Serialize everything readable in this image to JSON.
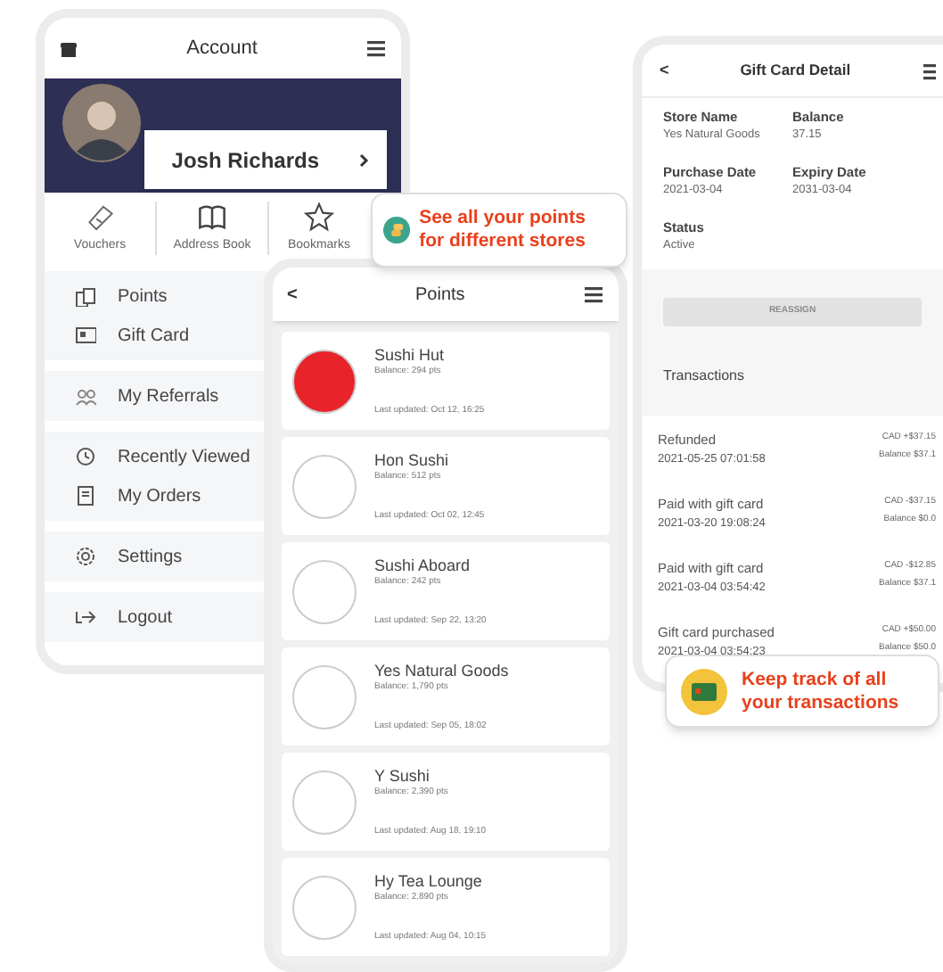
{
  "account_screen": {
    "title": "Account",
    "profile": {
      "name": "Josh Richards"
    },
    "shortcuts": [
      {
        "label": "Vouchers"
      },
      {
        "label": "Address Book"
      },
      {
        "label": "Bookmarks"
      }
    ],
    "menu_groups": [
      {
        "items": [
          {
            "label": "Points"
          },
          {
            "label": "Gift Card"
          }
        ]
      },
      {
        "items": [
          {
            "label": "My Referrals"
          }
        ]
      },
      {
        "items": [
          {
            "label": "Recently Viewed"
          },
          {
            "label": "My Orders"
          }
        ]
      },
      {
        "items": [
          {
            "label": "Settings"
          }
        ]
      },
      {
        "items": [
          {
            "label": "Logout"
          }
        ]
      }
    ]
  },
  "points_callout": {
    "text": "See all your points for different stores"
  },
  "points_screen": {
    "title": "Points",
    "back": "<",
    "stores": [
      {
        "name": "Sushi Hut",
        "balance": "Balance: 294 pts",
        "updated": "Last updated: Oct 12, 16:25",
        "color": "#e8232a"
      },
      {
        "name": "Hon Sushi",
        "balance": "Balance: 512 pts",
        "updated": "Last updated: Oct 02, 12:45",
        "color": "#ffffff"
      },
      {
        "name": "Sushi Aboard",
        "balance": "Balance: 242 pts",
        "updated": "Last updated: Sep 22, 13:20",
        "color": "#ffffff"
      },
      {
        "name": "Yes Natural Goods",
        "balance": "Balance: 1,790 pts",
        "updated": "Last updated: Sep 05, 18:02",
        "color": "#ffffff"
      },
      {
        "name": "Y Sushi",
        "balance": "Balance: 2,390 pts",
        "updated": "Last updated: Aug 18, 19:10",
        "color": "#ffffff"
      },
      {
        "name": "Hy Tea Lounge",
        "balance": "Balance: 2,890 pts",
        "updated": "Last updated: Aug 04, 10:15",
        "color": "#ffffff"
      }
    ]
  },
  "gift_card_screen": {
    "title": "Gift Card Detail",
    "back": "<",
    "fields": [
      {
        "label": "Store Name",
        "value": "Yes Natural Goods"
      },
      {
        "label": "Balance",
        "value": "37.15"
      },
      {
        "label": "Purchase Date",
        "value": "2021-03-04"
      },
      {
        "label": "Expiry Date",
        "value": "2031-03-04"
      },
      {
        "label": "Status",
        "value": "Active"
      }
    ],
    "reassign_button": {
      "label": "REASSIGN",
      "disabled": true
    },
    "transactions_heading": "Transactions",
    "transactions": [
      {
        "title": "Refunded",
        "datetime": "2021-05-25 07:01:58",
        "amount": "CAD +$37.15",
        "balance": "Balance $37.1"
      },
      {
        "title": "Paid with gift card",
        "datetime": "2021-03-20 19:08:24",
        "amount": "CAD -$37.15",
        "balance": "Balance $0.0"
      },
      {
        "title": "Paid with gift card",
        "datetime": "2021-03-04 03:54:42",
        "amount": "CAD -$12.85",
        "balance": "Balance $37.1"
      },
      {
        "title": "Gift card purchased",
        "datetime": "2021-03-04 03:54:23",
        "amount": "CAD +$50.00",
        "balance": "Balance $50.0"
      }
    ]
  },
  "transactions_callout": {
    "text": "Keep track of all your transactions"
  }
}
